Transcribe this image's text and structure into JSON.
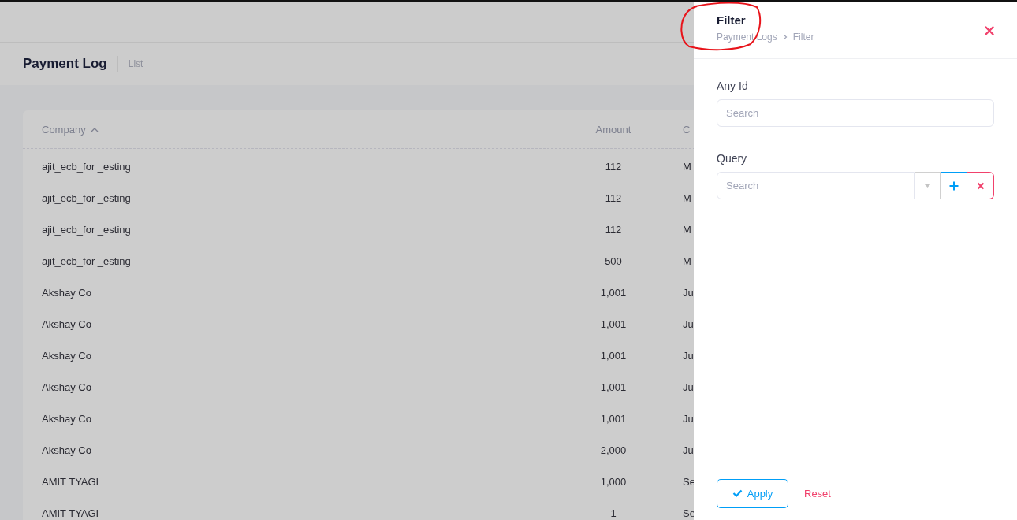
{
  "page": {
    "title": "Payment Log",
    "subtitle": "List"
  },
  "table": {
    "columns": [
      {
        "label": "Company",
        "sorted": true
      },
      {
        "label": "Amount",
        "sorted": false
      },
      {
        "label": "C",
        "sorted": false
      }
    ],
    "rows": [
      {
        "company": "ajit_ecb_for _esting",
        "amount": "112",
        "column_3": "M"
      },
      {
        "company": "ajit_ecb_for _esting",
        "amount": "112",
        "column_3": "M"
      },
      {
        "company": "ajit_ecb_for _esting",
        "amount": "112",
        "column_3": "M"
      },
      {
        "company": "ajit_ecb_for _esting",
        "amount": "500",
        "column_3": "M"
      },
      {
        "company": "Akshay Co",
        "amount": "1,001",
        "column_3": "Ju"
      },
      {
        "company": "Akshay Co",
        "amount": "1,001",
        "column_3": "Ju"
      },
      {
        "company": "Akshay Co",
        "amount": "1,001",
        "column_3": "Ju"
      },
      {
        "company": "Akshay Co",
        "amount": "1,001",
        "column_3": "Ju"
      },
      {
        "company": "Akshay Co",
        "amount": "1,001",
        "column_3": "Ju"
      },
      {
        "company": "Akshay Co",
        "amount": "2,000",
        "column_3": "Ju"
      },
      {
        "company": "AMIT TYAGI",
        "amount": "1,000",
        "column_3": "Se"
      },
      {
        "company": "AMIT TYAGI",
        "amount": "1",
        "column_3": "Se"
      }
    ]
  },
  "filter_panel": {
    "title": "Filter",
    "breadcrumb": [
      "Payment Logs",
      "Filter"
    ],
    "fields": [
      {
        "kind": "text",
        "label": "Any Id",
        "placeholder": "Search"
      },
      {
        "kind": "query",
        "label": "Query",
        "placeholder": "Search"
      }
    ],
    "apply": "Apply",
    "reset": "Reset"
  },
  "annotation": {
    "kind": "circle"
  }
}
